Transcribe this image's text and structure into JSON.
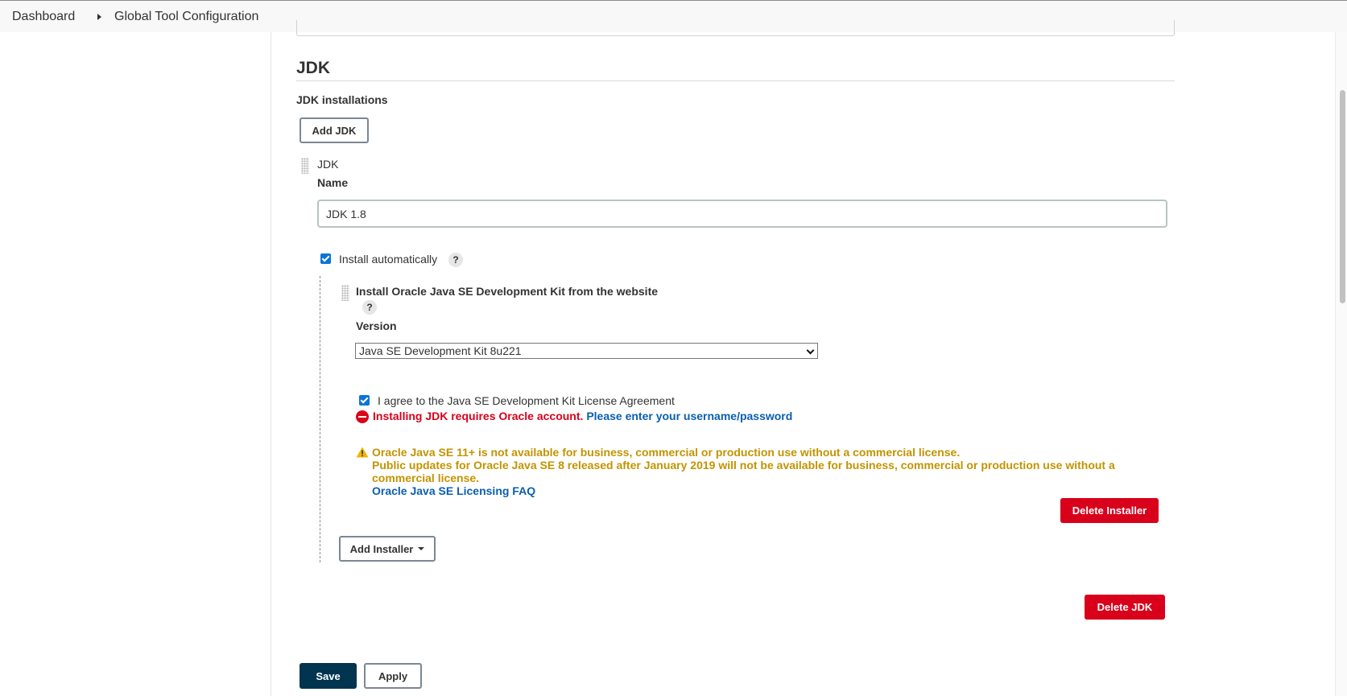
{
  "breadcrumb": {
    "items": [
      "Dashboard",
      "Global Tool Configuration"
    ],
    "separator_icon": "chevron-right-icon"
  },
  "jdk_section": {
    "title": "JDK",
    "installations_label": "JDK installations",
    "add_button_label": "Add JDK",
    "item": {
      "header": "JDK",
      "name_label": "Name",
      "name_value": "JDK 1.8",
      "install_automatically": {
        "label": "Install automatically",
        "checked": true,
        "help": "?"
      },
      "installer": {
        "title": "Install Oracle Java SE Development Kit from the website",
        "help": "?",
        "version_label": "Version",
        "version_selected": "Java SE Development Kit 8u221",
        "agree": {
          "label": "I agree to the Java SE Development Kit License Agreement",
          "checked": true
        },
        "error_text": "Installing JDK requires Oracle account.",
        "error_link": "Please enter your username/password",
        "warning_line1": "Oracle Java SE 11+ is not available for business, commercial or production use without a commercial license.",
        "warning_line2": "Public updates for Oracle Java SE 8 released after January 2019 will not be available for business, commercial or production use without a",
        "warning_line3": "commercial license.",
        "warning_link": "Oracle Java SE Licensing FAQ",
        "delete_label": "Delete Installer"
      },
      "add_installer_label": "Add Installer",
      "delete_label": "Delete JDK"
    }
  },
  "footer": {
    "save_label": "Save",
    "apply_label": "Apply"
  },
  "colors": {
    "danger": "#d9001b",
    "primary": "#00344f",
    "link": "#0b5fad",
    "warning": "#c29400",
    "checkbox": "#0b74d6"
  }
}
